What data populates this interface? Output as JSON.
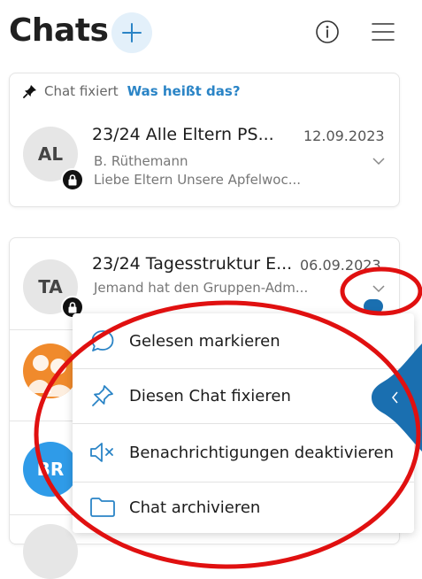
{
  "header": {
    "title": "Chats",
    "add_icon": "plus-icon",
    "info_icon": "info-icon",
    "menu_icon": "hamburger-icon"
  },
  "pinned": {
    "pin_label": "Chat fixiert",
    "help_link": "Was heißt das?",
    "chat": {
      "initials": "AL",
      "name": "23/24 Alle Eltern PS...",
      "date": "12.09.2023",
      "sender": "B. Rüthemann",
      "preview": "Liebe Eltern  Unsere Apfelwoc..."
    }
  },
  "chats": [
    {
      "initials": "TA",
      "name": "23/24 Tagesstruktur E...",
      "date": "06.09.2023",
      "preview": "Jemand hat den Gruppen-Adm..."
    },
    {
      "initials": ""
    },
    {
      "initials": "BR"
    }
  ],
  "context_menu": {
    "items": [
      {
        "label": "Gelesen markieren",
        "icon": "speech-bubble-icon"
      },
      {
        "label": "Diesen Chat fixieren",
        "icon": "pin-icon"
      },
      {
        "label": "Benachrichtigungen deaktivieren",
        "icon": "mute-speaker-icon"
      },
      {
        "label": "Chat archivieren",
        "icon": "folder-icon"
      }
    ]
  },
  "colors": {
    "accent": "#2a84c6",
    "side_tab": "#1a6fb0",
    "annotation": "#e01010",
    "badge": "#111111"
  }
}
